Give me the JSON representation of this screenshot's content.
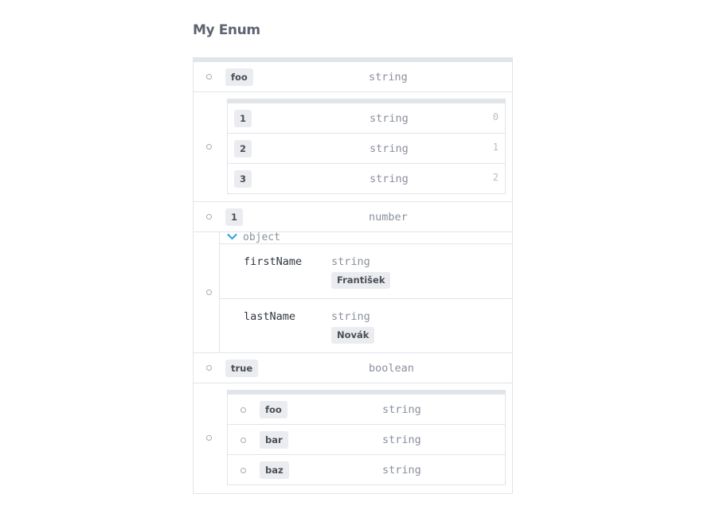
{
  "title": "My Enum",
  "rows": [
    {
      "value": "foo",
      "type": "string"
    },
    {
      "items": [
        {
          "value": "1",
          "type": "string",
          "index": "0"
        },
        {
          "value": "2",
          "type": "string",
          "index": "1"
        },
        {
          "value": "3",
          "type": "string",
          "index": "2"
        }
      ]
    },
    {
      "value": "1",
      "type": "number"
    },
    {
      "object": {
        "label": "object",
        "properties": [
          {
            "name": "firstName",
            "type": "string",
            "value": "František"
          },
          {
            "name": "lastName",
            "type": "string",
            "value": "Novák"
          }
        ]
      }
    },
    {
      "value": "true",
      "type": "boolean"
    },
    {
      "items": [
        {
          "value": "foo",
          "type": "string"
        },
        {
          "value": "bar",
          "type": "string"
        },
        {
          "value": "baz",
          "type": "string"
        }
      ]
    }
  ],
  "icons": {
    "expand": "chevron-down-icon",
    "bullet": "bullet-dot-icon"
  },
  "colors": {
    "accent": "#3aa3d9",
    "chip_bg": "#ebecef",
    "border": "#e1e4e8"
  }
}
